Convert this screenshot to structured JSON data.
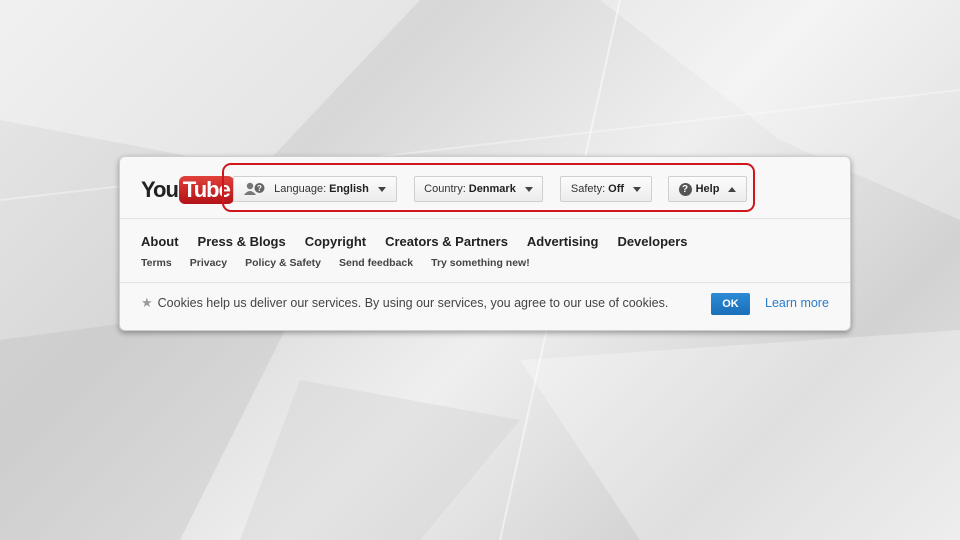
{
  "logo": {
    "you": "You",
    "tube": "Tube"
  },
  "pickers": {
    "language": {
      "label": "Language:",
      "value": "English",
      "icon": "language-people-icon"
    },
    "country": {
      "label": "Country:",
      "value": "Denmark"
    },
    "safety": {
      "label": "Safety:",
      "value": "Off"
    },
    "help": {
      "label": "Help",
      "icon": "question-icon"
    }
  },
  "primary_links": [
    "About",
    "Press & Blogs",
    "Copyright",
    "Creators & Partners",
    "Advertising",
    "Developers"
  ],
  "secondary_links": [
    "Terms",
    "Privacy",
    "Policy & Safety",
    "Send feedback",
    "Try something new!"
  ],
  "cookie_notice": {
    "text": "Cookies help us deliver our services. By using our services, you agree to our use of cookies.",
    "ok_label": "OK",
    "learn_more_label": "Learn more"
  },
  "colors": {
    "highlight": "#d0151b",
    "ok_button": "#1f7bc7",
    "link": "#2a7ccc",
    "logo_red": "#c4302b"
  }
}
